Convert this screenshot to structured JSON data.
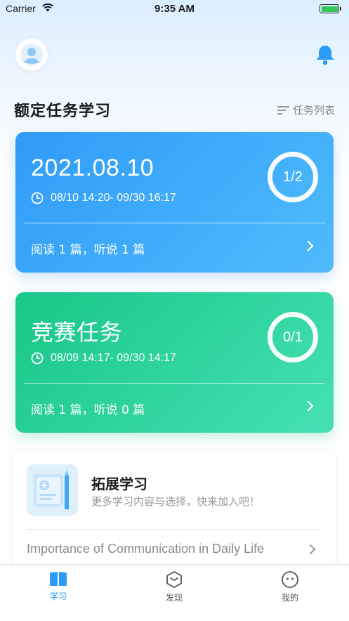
{
  "status_bar": {
    "carrier": "Carrier",
    "time": "9:35 AM"
  },
  "header": {
    "section_title": "额定任务学习",
    "task_list_label": "任务列表"
  },
  "cards": [
    {
      "title": "2021.08.10",
      "time_range": "08/10 14:20- 09/30 16:17",
      "progress": "1/2",
      "summary": "阅读 1 篇，听说 1 篇",
      "color": "#2f9bf8"
    },
    {
      "title": "竞赛任务",
      "time_range": "08/09 14:17- 09/30 14:17",
      "progress": "0/1",
      "summary": "阅读 1 篇，听说 0 篇",
      "color": "#19c787"
    }
  ],
  "extend": {
    "title": "拓展学习",
    "subtitle": "更多学习内容与选择，快来加入吧！",
    "article": "Importance of Communication in Daily Life"
  },
  "tabs": [
    {
      "label": "学习",
      "icon": "book-icon",
      "active": true
    },
    {
      "label": "发现",
      "icon": "discover-icon",
      "active": false
    },
    {
      "label": "我的",
      "icon": "profile-face-icon",
      "active": false
    }
  ],
  "colors": {
    "accent": "#2f9bf8",
    "green": "#19c787",
    "text_secondary": "#999999"
  }
}
